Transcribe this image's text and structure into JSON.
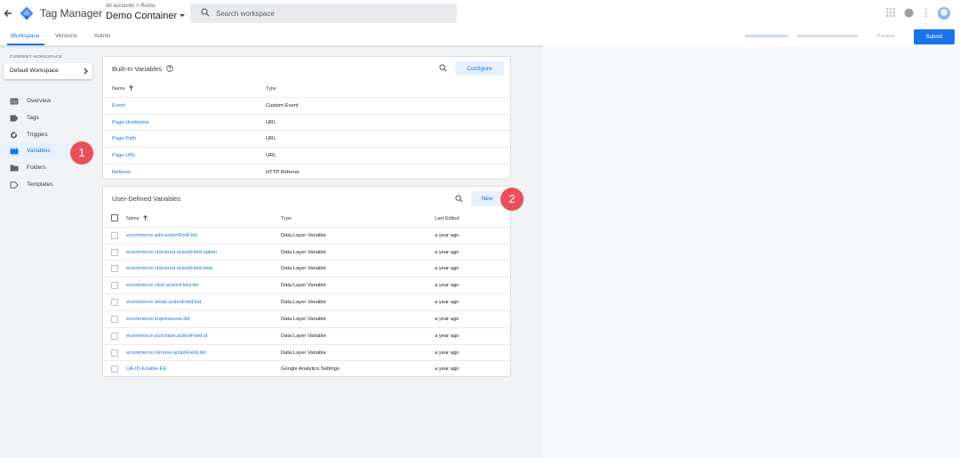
{
  "header": {
    "app_title": "Tag Manager",
    "breadcrumb": "All accounts > Renta",
    "container_name": "Demo Container",
    "search_placeholder": "Search workspace"
  },
  "tabs": [
    {
      "label": "Workspace",
      "active": true
    },
    {
      "label": "Versions",
      "active": false
    },
    {
      "label": "Admin",
      "active": false
    }
  ],
  "right_bar": {
    "preview_label": "Preview",
    "submit_label": "Submit"
  },
  "sidebar": {
    "workspace_label": "CURRENT WORKSPACE",
    "workspace_name": "Default Workspace",
    "items": [
      {
        "label": "Overview",
        "icon": "overview-icon",
        "active": false
      },
      {
        "label": "Tags",
        "icon": "tag-icon",
        "active": false
      },
      {
        "label": "Triggers",
        "icon": "trigger-icon",
        "active": false
      },
      {
        "label": "Variables",
        "icon": "variables-icon",
        "active": true
      },
      {
        "label": "Folders",
        "icon": "folder-icon",
        "active": false
      },
      {
        "label": "Templates",
        "icon": "template-icon",
        "active": false
      }
    ]
  },
  "badges": {
    "one": "1",
    "two": "2"
  },
  "builtin": {
    "title": "Built-In Variables",
    "configure_label": "Configure",
    "columns": {
      "name": "Name",
      "type": "Type"
    },
    "rows": [
      {
        "name": "Event",
        "type": "Custom Event"
      },
      {
        "name": "Page Hostname",
        "type": "URL"
      },
      {
        "name": "Page Path",
        "type": "URL"
      },
      {
        "name": "Page URL",
        "type": "URL"
      },
      {
        "name": "Referrer",
        "type": "HTTP Referrer"
      }
    ]
  },
  "user_defined": {
    "title": "User-Defined Variables",
    "new_label": "New",
    "columns": {
      "name": "Name",
      "type": "Type",
      "last_edited": "Last Edited"
    },
    "rows": [
      {
        "name": "ecommerce.add.actionField.list",
        "type": "Data Layer Variable",
        "edited": "a year ago"
      },
      {
        "name": "ecommerce.checkout.actionField.option",
        "type": "Data Layer Variable",
        "edited": "a year ago"
      },
      {
        "name": "ecommerce.checkout.actionField.step",
        "type": "Data Layer Variable",
        "edited": "a year ago"
      },
      {
        "name": "ecommerce.click.actionField.list",
        "type": "Data Layer Variable",
        "edited": "a year ago"
      },
      {
        "name": "ecommerce.detail.actionField.list",
        "type": "Data Layer Variable",
        "edited": "a year ago"
      },
      {
        "name": "ecommerce.impressions.list",
        "type": "Data Layer Variable",
        "edited": "a year ago"
      },
      {
        "name": "ecommerce.purchase.actionField.id",
        "type": "Data Layer Variable",
        "edited": "a year ago"
      },
      {
        "name": "ecommerce.remove.actionField.list",
        "type": "Data Layer Variable",
        "edited": "a year ago"
      },
      {
        "name": "UA-ID-Enable-EE",
        "type": "Google Analytics Settings",
        "edited": "a year ago"
      }
    ]
  },
  "colors": {
    "accent": "#1a73e8",
    "badge": "#e8505b",
    "active_nav_bg": "#e8f0fe"
  }
}
